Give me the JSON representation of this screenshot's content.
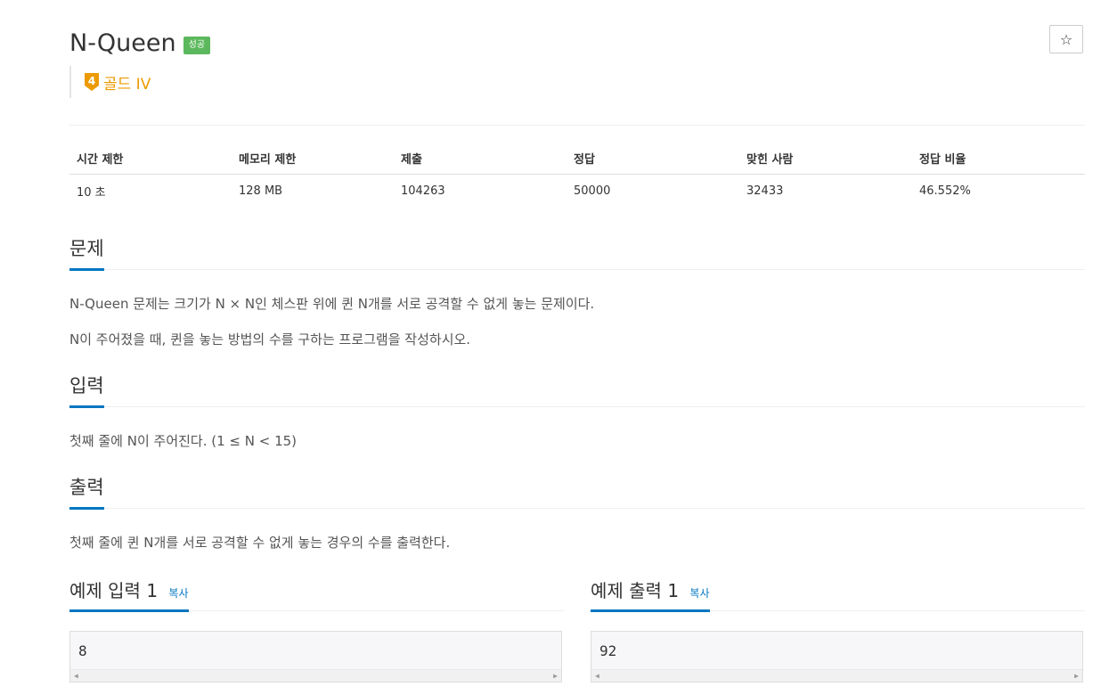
{
  "problem": {
    "title": "N-Queen",
    "result_badge": "성공",
    "tier_label": "골드 IV",
    "tier_number": "4"
  },
  "info_table": {
    "headers": [
      "시간 제한",
      "메모리 제한",
      "제출",
      "정답",
      "맞힌 사람",
      "정답 비율"
    ],
    "values": [
      "10 초",
      "128 MB",
      "104263",
      "50000",
      "32433",
      "46.552%"
    ]
  },
  "sections": {
    "problem": {
      "heading": "문제",
      "paragraphs": [
        "N-Queen 문제는 크기가 N × N인 체스판 위에 퀸 N개를 서로 공격할 수 없게 놓는 문제이다.",
        "N이 주어졌을 때, 퀸을 놓는 방법의 수를 구하는 프로그램을 작성하시오."
      ]
    },
    "input": {
      "heading": "입력",
      "text": "첫째 줄에 N이 주어진다. (1 ≤ N < 15)"
    },
    "output": {
      "heading": "출력",
      "text": "첫째 줄에 퀸 N개를 서로 공격할 수 없게 놓는 경우의 수를 출력한다."
    }
  },
  "samples": {
    "input_heading": "예제 입력 1",
    "output_heading": "예제 출력 1",
    "copy_label": "복사",
    "input_value": "8",
    "output_value": "92"
  },
  "icons": {
    "star": "star-icon",
    "tier": "tier-badge-icon"
  },
  "colors": {
    "accent": "#0076c0",
    "success": "#5cb85c",
    "gold_tier": "#ec9a00"
  }
}
